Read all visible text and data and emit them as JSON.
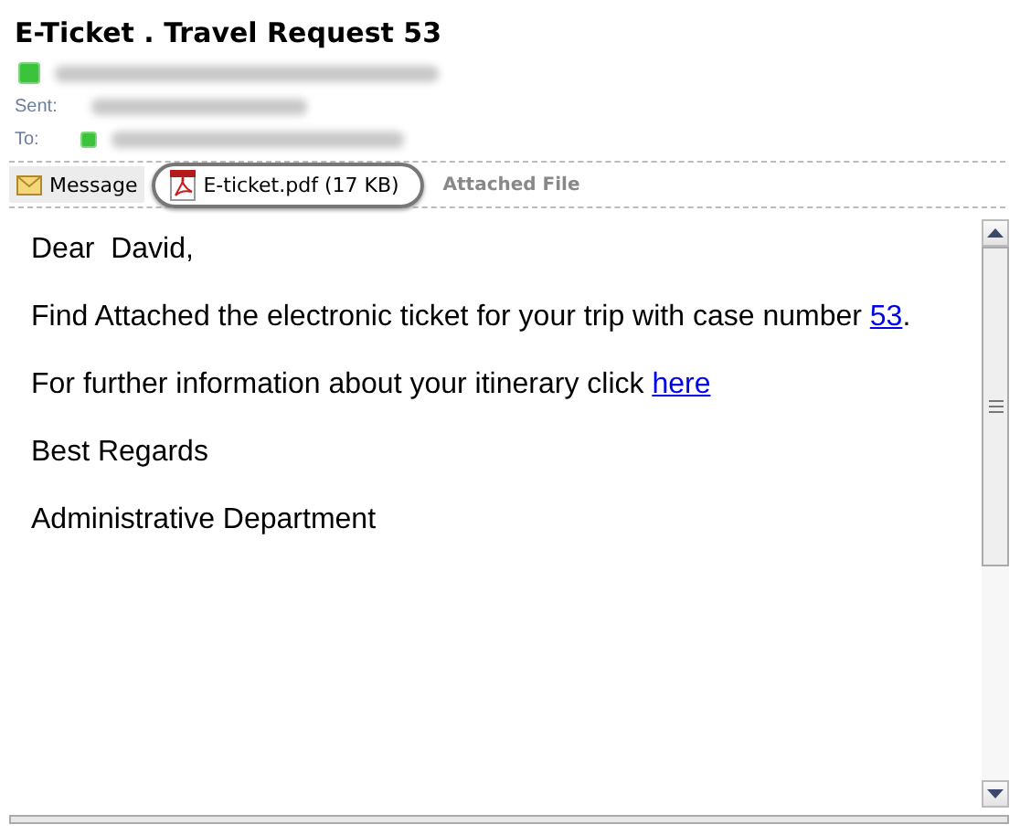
{
  "subject": "E-Ticket . Travel Request 53",
  "header_labels": {
    "sent": "Sent:",
    "to": "To:"
  },
  "attachments": [
    {
      "kind": "message",
      "label": "Message",
      "selected": false
    },
    {
      "kind": "pdf",
      "label": "E-ticket.pdf (17 KB)",
      "selected": true
    }
  ],
  "attachments_note": "Attached File",
  "body": [
    {
      "text": "Dear  David,"
    },
    {
      "text": "Find Attached the electronic ticket for your trip with case number ",
      "link": "53",
      "after": "."
    },
    {
      "text": "For further information about your itinerary click ",
      "link": "here"
    },
    {
      "text": "Best Regards"
    },
    {
      "text": "Administrative Department"
    }
  ]
}
